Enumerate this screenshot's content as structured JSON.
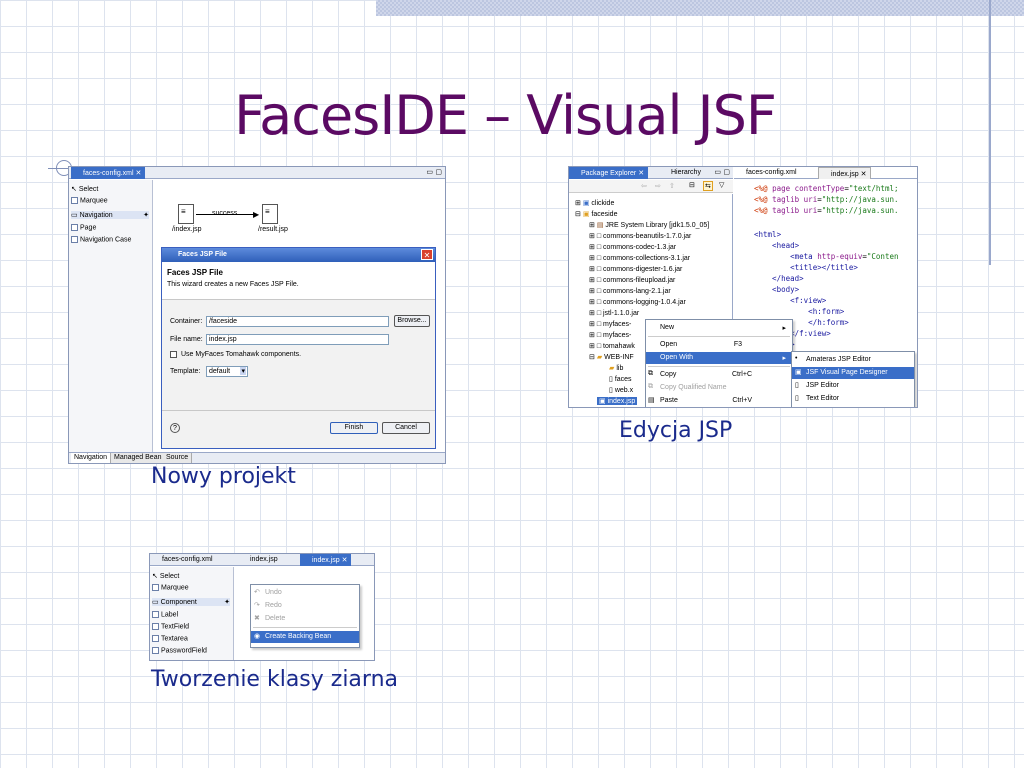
{
  "slide": {
    "title": "FacesIDE – Visual JSF"
  },
  "captions": {
    "new_project": "Nowy projekt",
    "edit_jsp": "Edycja JSP",
    "bean_class": "Tworzenie klasy ziarna"
  },
  "shot1": {
    "tab": "faces-config.xml",
    "palette": [
      "Select",
      "Marquee",
      "Navigation",
      "Page",
      "Navigation Case"
    ],
    "nodes": {
      "from": "/index.jsp",
      "to": "/result.jsp",
      "edge": "success"
    },
    "dialog": {
      "title": "Faces JSP File",
      "heading": "Faces JSP File",
      "desc": "This wizard creates a new Faces JSP File.",
      "container_label": "Container:",
      "container_value": "/faceside",
      "browse": "Browse...",
      "filename_label": "File name:",
      "filename_value": "index.jsp",
      "checkbox_label": "Use MyFaces Tomahawk components.",
      "template_label": "Template:",
      "template_value": "default",
      "help": "?",
      "finish": "Finish",
      "cancel": "Cancel"
    },
    "bottom_tabs": [
      "Navigation",
      "Managed Bean",
      "Source"
    ]
  },
  "shot2": {
    "left_tabs": [
      "Package Explorer",
      "Hierarchy"
    ],
    "right_tabs": [
      "faces-config.xml",
      "index.jsp"
    ],
    "tree": [
      "clickide",
      "faceside",
      "JRE System Library [jdk1.5.0_05]",
      "commons-beanutils-1.7.0.jar",
      "commons-codec-1.3.jar",
      "commons-collections-3.1.jar",
      "commons-digester-1.6.jar",
      "commons-fileupload.jar",
      "commons-lang-2.1.jar",
      "commons-logging-1.0.4.jar",
      "jstl-1.1.0.jar",
      "myfaces-",
      "myfaces-",
      "tomahawk",
      "WEB-INF",
      "lib",
      "faces",
      "web.x",
      "index.jsp"
    ],
    "code": [
      "<%@ page contentType=\"text/html;",
      "<%@ taglib uri=\"http://java.sun.",
      "<%@ taglib uri=\"http://java.sun.",
      "",
      "<html>",
      "    <head>",
      "        <meta http-equiv=\"Conten",
      "        <title></title>",
      "    </head>",
      "    <body>",
      "        <f:view>",
      "            <h:form>",
      "            </h:form>",
      "        </f:view>",
      "    body>"
    ],
    "context_menu": [
      {
        "label": "New",
        "shortcut": ""
      },
      {
        "label": "Open",
        "shortcut": "F3"
      },
      {
        "label": "Open With",
        "shortcut": ""
      },
      {
        "label": "Copy",
        "shortcut": "Ctrl+C"
      },
      {
        "label": "Copy Qualified Name",
        "shortcut": ""
      },
      {
        "label": "Paste",
        "shortcut": "Ctrl+V"
      }
    ],
    "submenu": [
      "Amateras JSP Editor",
      "JSF Visual Page Designer",
      "JSP Editor",
      "Text Editor"
    ]
  },
  "shot3": {
    "tabs": [
      "faces-config.xml",
      "index.jsp",
      "index.jsp"
    ],
    "palette": [
      "Select",
      "Marquee",
      "Component",
      "Label",
      "TextField",
      "Textarea",
      "PasswordField"
    ],
    "menu": [
      "Undo",
      "Redo",
      "Delete",
      "Create Backing Bean"
    ]
  }
}
